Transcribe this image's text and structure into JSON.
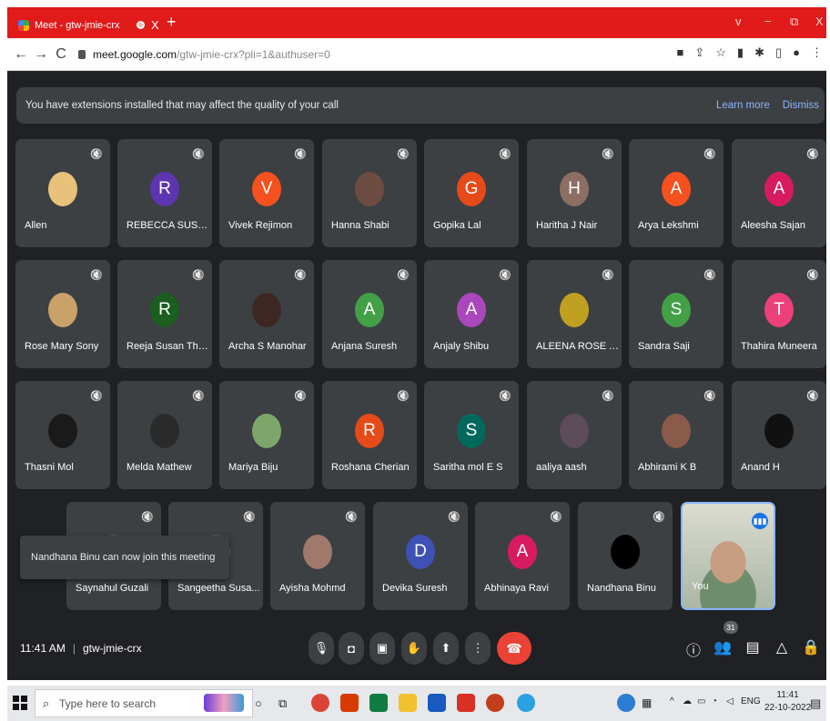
{
  "browser": {
    "tab_title": "Meet - gtw-jmie-crx",
    "tab_close": "X",
    "new_tab": "+",
    "window_controls": [
      "v",
      "−",
      "⧉",
      "X"
    ],
    "url_host": "meet.google.com",
    "url_path": "/gtw-jmie-crx?pli=1&authuser=0"
  },
  "banner": {
    "text": "You have extensions installed that may affect the quality of your call",
    "learn_more": "Learn more",
    "dismiss": "Dismiss"
  },
  "participants": [
    {
      "name": "Allen",
      "initial": "",
      "color": "#e8c27a"
    },
    {
      "name": "REBECCA SUSA...",
      "initial": "R",
      "color": "#5e35b1"
    },
    {
      "name": "Vivek Rejimon",
      "initial": "V",
      "color": "#f4511e"
    },
    {
      "name": "Hanna Shabi",
      "initial": "",
      "color": "#6d4c41"
    },
    {
      "name": "Gopika Lal",
      "initial": "G",
      "color": "#e64a19"
    },
    {
      "name": "Haritha J Nair",
      "initial": "H",
      "color": "#8d6e63"
    },
    {
      "name": "Arya Lekshmi",
      "initial": "A",
      "color": "#f4511e"
    },
    {
      "name": "Aleesha Sajan",
      "initial": "A",
      "color": "#d81b60"
    },
    {
      "name": "Rose Mary Sony",
      "initial": "",
      "color": "#c9a26a"
    },
    {
      "name": "Reeja Susan Tho...",
      "initial": "R",
      "color": "#1b5e20"
    },
    {
      "name": "Archa S Manohar",
      "initial": "",
      "color": "#3e2723"
    },
    {
      "name": "Anjana Suresh",
      "initial": "A",
      "color": "#43a047"
    },
    {
      "name": "Anjaly Shibu",
      "initial": "A",
      "color": "#ab47bc"
    },
    {
      "name": "ALEENA ROSE T...",
      "initial": "",
      "color": "#c0a020"
    },
    {
      "name": "Sandra Saji",
      "initial": "S",
      "color": "#43a047"
    },
    {
      "name": "Thahira Muneera",
      "initial": "T",
      "color": "#ec407a"
    },
    {
      "name": "Thasni Mol",
      "initial": "",
      "color": "#1a1a1a"
    },
    {
      "name": "Melda Mathew",
      "initial": "",
      "color": "#2a2a2a"
    },
    {
      "name": "Mariya Biju",
      "initial": "",
      "color": "#7fa66a"
    },
    {
      "name": "Roshana Cherian",
      "initial": "R",
      "color": "#e64a19"
    },
    {
      "name": "Saritha mol E S",
      "initial": "S",
      "color": "#00695c"
    },
    {
      "name": "aaliya aash",
      "initial": "",
      "color": "#5d4c5a"
    },
    {
      "name": "Abhirami K B",
      "initial": "",
      "color": "#8a5a4a"
    },
    {
      "name": "Anand H",
      "initial": "",
      "color": "#111111"
    },
    {
      "name": "Saynahul Guzali",
      "initial": "",
      "color": "#5f6368"
    },
    {
      "name": "Sangeetha Susa...",
      "initial": "",
      "color": "#5f6368"
    },
    {
      "name": "Ayisha Mohmd",
      "initial": "",
      "color": "#a0796a"
    },
    {
      "name": "Devika Suresh",
      "initial": "D",
      "color": "#3f51b5"
    },
    {
      "name": "Abhinaya Ravi",
      "initial": "A",
      "color": "#d81b60"
    },
    {
      "name": "Nandhana Binu",
      "initial": "",
      "color": "#000000"
    },
    {
      "name": "You",
      "initial": "",
      "color": "#8ab4f8"
    }
  ],
  "toast": "Nandhana Binu can now join this meeting",
  "meeting": {
    "time": "11:41 AM",
    "separator": "|",
    "code": "gtw-jmie-crx",
    "participant_count": "31"
  },
  "taskbar": {
    "search_placeholder": "Type here to search",
    "language": "ENG",
    "time": "11:41",
    "date": "22-10-2022"
  }
}
